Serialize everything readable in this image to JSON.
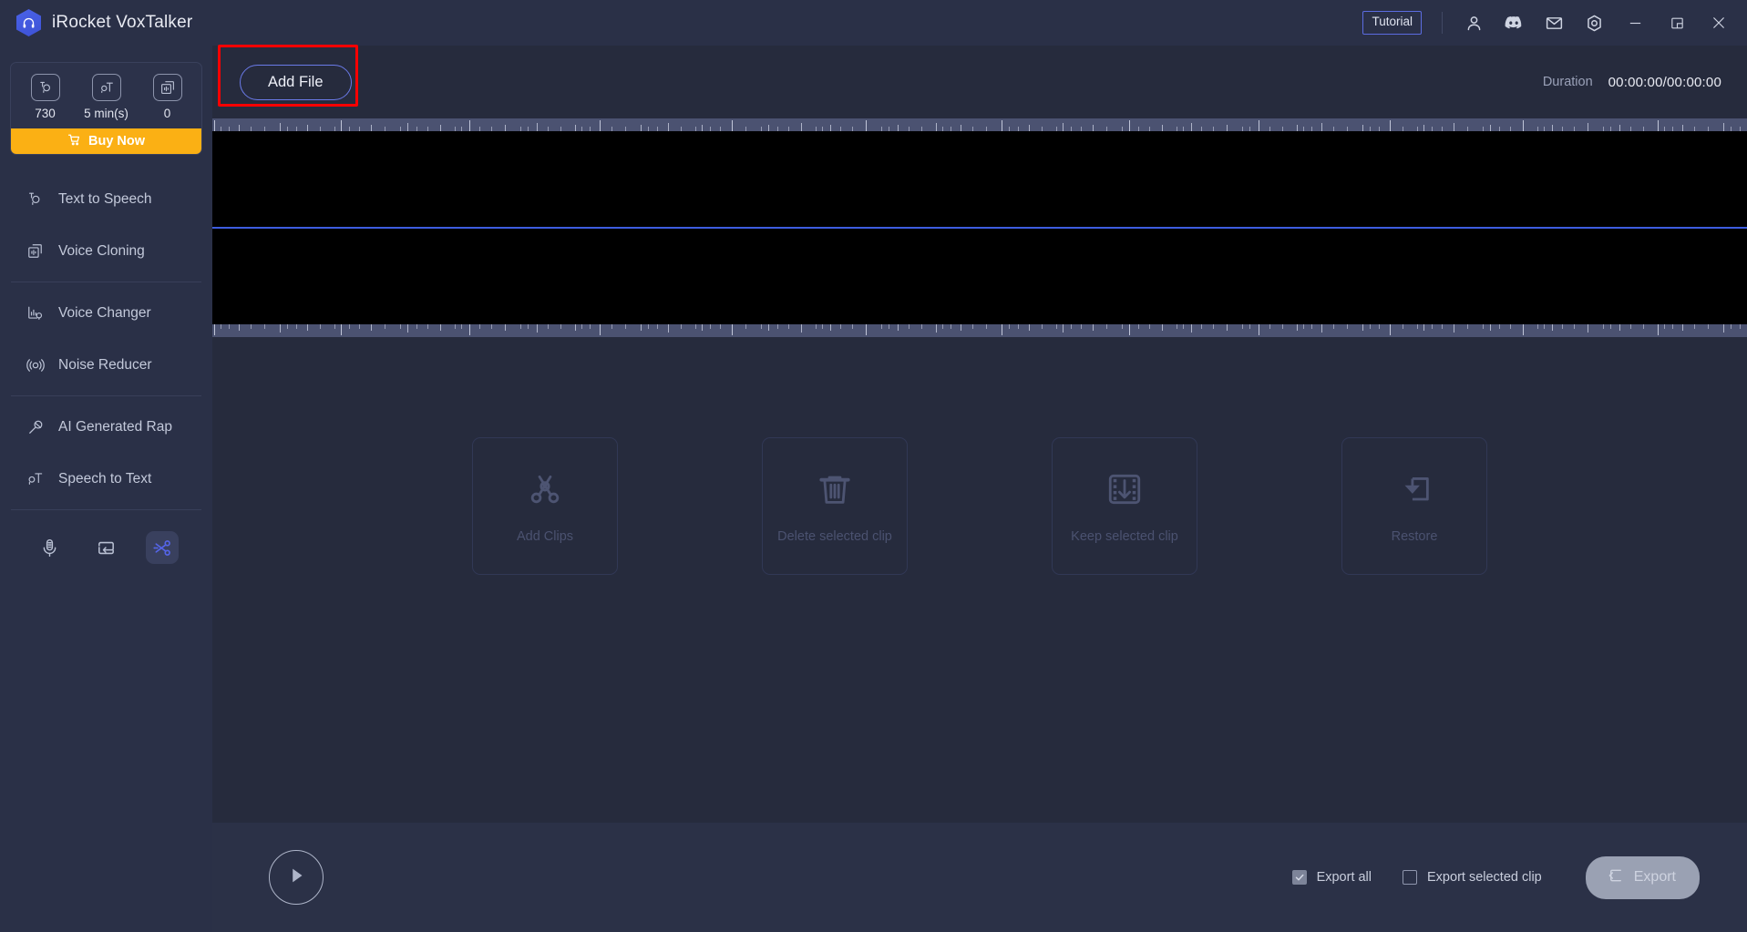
{
  "window": {
    "title": "iRocket VoxTalker",
    "logo_icon": "headphones-hexagon-logo",
    "tutorial_label": "Tutorial",
    "icons": [
      {
        "name": "account-icon",
        "label": "Account"
      },
      {
        "name": "discord-icon",
        "label": "Discord"
      },
      {
        "name": "mail-icon",
        "label": "Mail"
      },
      {
        "name": "settings-icon",
        "label": "Settings"
      },
      {
        "name": "minimize-icon",
        "label": "Minimize"
      },
      {
        "name": "maximize-icon",
        "label": "Maximize"
      },
      {
        "name": "close-icon",
        "label": "Close"
      }
    ]
  },
  "sidebar": {
    "stats": [
      {
        "icon": "characters-icon",
        "value": "730"
      },
      {
        "icon": "speech-time-icon",
        "value": "5 min(s)"
      },
      {
        "icon": "clone-icon",
        "value": "0"
      }
    ],
    "buy_label": "Buy Now",
    "buy_icon": "cart-icon",
    "nav": [
      {
        "icon": "text-to-speech-icon",
        "label": "Text to Speech"
      },
      {
        "icon": "voice-cloning-icon",
        "label": "Voice Cloning"
      },
      {
        "icon": "voice-changer-icon",
        "label": "Voice Changer"
      },
      {
        "icon": "noise-reducer-icon",
        "label": "Noise Reducer"
      },
      {
        "icon": "ai-rap-icon",
        "label": "AI Generated Rap"
      },
      {
        "icon": "speech-to-text-icon",
        "label": "Speech to Text"
      }
    ],
    "tools": [
      {
        "icon": "microphone-icon",
        "active": false
      },
      {
        "icon": "loop-icon",
        "active": false
      },
      {
        "icon": "scissors-icon",
        "active": true
      }
    ]
  },
  "toolbar": {
    "add_file_label": "Add File",
    "duration_label": "Duration",
    "duration_value": "00:00:00/00:00:00",
    "highlight_color": "#fe0000"
  },
  "editor": {
    "actions": [
      {
        "icon": "add-clips-scissors-icon",
        "label": "Add Clips"
      },
      {
        "icon": "trash-icon",
        "label": "Delete selected clip"
      },
      {
        "icon": "film-download-icon",
        "label": "Keep selected clip"
      },
      {
        "icon": "restore-arrow-icon",
        "label": "Restore"
      }
    ]
  },
  "footer": {
    "play_icon": "play-icon",
    "export_all": {
      "label": "Export all",
      "checked": true
    },
    "export_selected": {
      "label": "Export selected clip",
      "checked": false
    },
    "export_button": {
      "label": "Export",
      "icon": "export-icon"
    }
  },
  "colors": {
    "accent_blue": "#5b6ce0",
    "buy_orange": "#fbb014",
    "highlight_red": "#fe0000",
    "panel": "#2a3047",
    "canvas": "#262b3d"
  }
}
